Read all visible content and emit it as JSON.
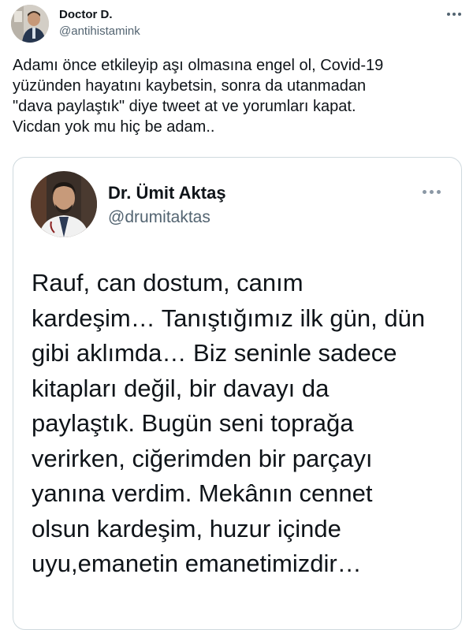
{
  "tweet": {
    "author": {
      "name": "Doctor D.",
      "handle": "@antihistamink"
    },
    "more_icon": "more-horizontal-icon",
    "text_lines": [
      "Adamı önce etkileyip aşı olmasına engel ol, Covid-19",
      "yüzünden hayatını kaybetsin, sonra da utanmadan",
      "\"dava paylaştık\" diye tweet at ve yorumları kapat.",
      "Vicdan yok mu hiç be adam.."
    ]
  },
  "quoted_tweet": {
    "author": {
      "name": "Dr. Ümit Aktaş",
      "handle": "@drumitaktas"
    },
    "more_icon": "more-horizontal-icon",
    "text_lines": [
      "Rauf, can dostum, canım",
      "kardeşim… Tanıştığımız ilk gün, dün",
      "gibi aklımda… Biz seninle sadece",
      "kitapları değil, bir davayı da",
      "paylaştık. Bugün seni toprağa",
      "verirken, ciğerimden bir parçayı",
      "yanına verdim. Mekânın cennet",
      "olsun kardeşim, huzur içinde",
      "uyu,emanetin emanetimizdir…"
    ]
  },
  "colors": {
    "text": "#0f1419",
    "secondary_text": "#536471",
    "border": "#cfd9de",
    "background": "#ffffff"
  }
}
